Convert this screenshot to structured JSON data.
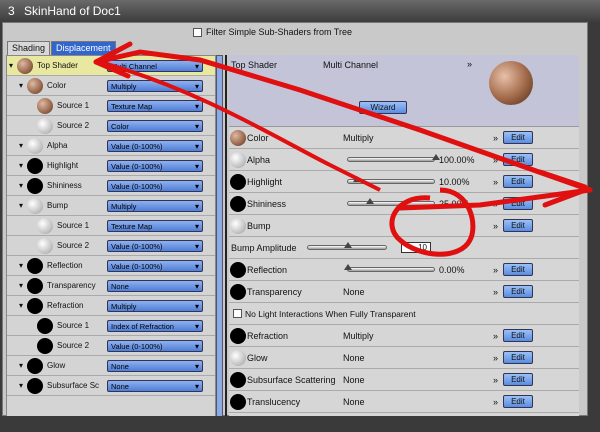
{
  "title": {
    "number": "3",
    "text": "SkinHand of Doc1"
  },
  "filter_label": "Filter Simple Sub-Shaders from Tree",
  "tabs": [
    "Shading",
    "Displacement"
  ],
  "tree": [
    {
      "label": "Top Shader",
      "select": "Multi Channel",
      "indent": 0,
      "ball": "copper"
    },
    {
      "label": "Color",
      "select": "Multiply",
      "indent": 1,
      "ball": "copper"
    },
    {
      "label": "Source 1",
      "select": "Texture Map",
      "indent": 2,
      "ball": "copper"
    },
    {
      "label": "Source 2",
      "select": "Color",
      "indent": 2,
      "ball": "white"
    },
    {
      "label": "Alpha",
      "select": "Value (0-100%)",
      "indent": 1,
      "ball": "white"
    },
    {
      "label": "Highlight",
      "select": "Value (0-100%)",
      "indent": 1,
      "ball": "black"
    },
    {
      "label": "Shininess",
      "select": "Value (0-100%)",
      "indent": 1,
      "ball": "black"
    },
    {
      "label": "Bump",
      "select": "Multiply",
      "indent": 1,
      "ball": "white"
    },
    {
      "label": "Source 1",
      "select": "Texture Map",
      "indent": 2,
      "ball": "white"
    },
    {
      "label": "Source 2",
      "select": "Value (0-100%)",
      "indent": 2,
      "ball": "white"
    },
    {
      "label": "Reflection",
      "select": "Value (0-100%)",
      "indent": 1,
      "ball": "black"
    },
    {
      "label": "Transparency",
      "select": "None",
      "indent": 1,
      "ball": "black"
    },
    {
      "label": "Refraction",
      "select": "Multiply",
      "indent": 1,
      "ball": "black"
    },
    {
      "label": "Source 1",
      "select": "Index of Refraction",
      "indent": 2,
      "ball": "black"
    },
    {
      "label": "Source 2",
      "select": "Value (0-100%)",
      "indent": 2,
      "ball": "black"
    },
    {
      "label": "Glow",
      "select": "None",
      "indent": 1,
      "ball": "black"
    },
    {
      "label": "Subsurface Sc",
      "select": "None",
      "indent": 1,
      "ball": "black"
    }
  ],
  "top": {
    "label": "Top Shader",
    "value": "Multi Channel",
    "wizard": "Wizard"
  },
  "props": [
    {
      "label": "Color",
      "value": "Multiply",
      "ball": "copper",
      "edit": "Edit"
    },
    {
      "label": "Alpha",
      "slider": 1.0,
      "pct": "100.00%",
      "ball": "white",
      "edit": "Edit"
    },
    {
      "label": "Highlight",
      "slider": 0.1,
      "pct": "10.00%",
      "ball": "black",
      "edit": "Edit"
    },
    {
      "label": "Shininess",
      "slider": 0.25,
      "pct": "25.00%",
      "ball": "black",
      "edit": "Edit"
    },
    {
      "label": "Bump",
      "value": "",
      "ball": "white",
      "edit": "Edit"
    },
    {
      "label": "Bump Amplitude",
      "slider": 0.5,
      "amp": "10",
      "ball": "",
      "edit": ""
    },
    {
      "label": "Reflection",
      "slider": 0.0,
      "pct": "0.00%",
      "ball": "black",
      "edit": "Edit"
    },
    {
      "label": "Transparency",
      "value": "None",
      "ball": "black",
      "edit": "Edit"
    },
    {
      "label": "No Light Interactions When Fully Transparent",
      "checkbox": true
    },
    {
      "label": "Refraction",
      "value": "Multiply",
      "ball": "black",
      "edit": "Edit"
    },
    {
      "label": "Glow",
      "value": "None",
      "ball": "white",
      "edit": "Edit"
    },
    {
      "label": "Subsurface Scattering",
      "value": "None",
      "ball": "black",
      "edit": "Edit"
    },
    {
      "label": "Translucency",
      "value": "None",
      "ball": "black",
      "edit": "Edit"
    }
  ]
}
